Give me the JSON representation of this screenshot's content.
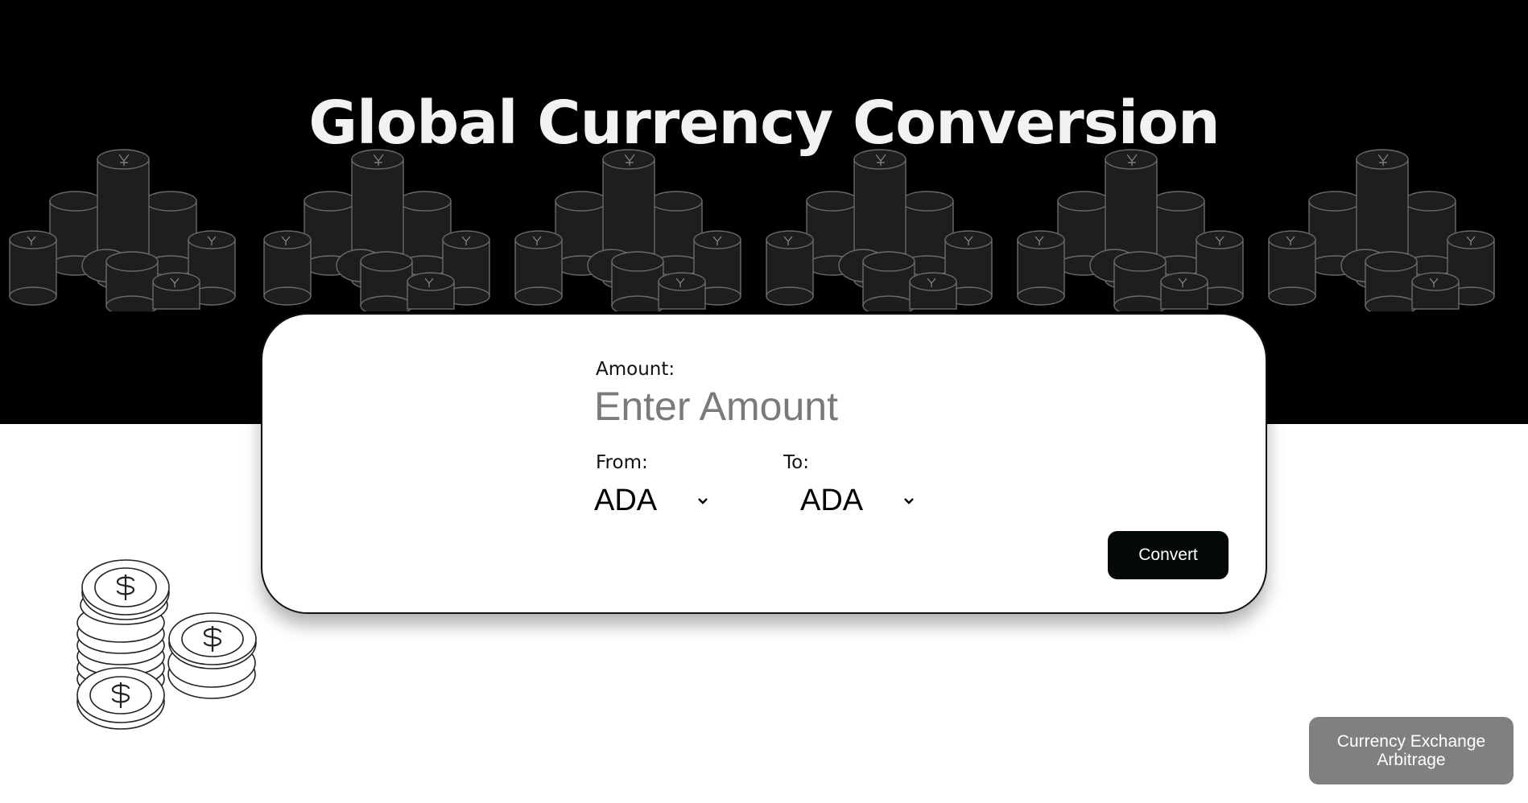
{
  "header": {
    "title": "Global Currency Conversion",
    "background_color": "#000000",
    "background_icon": "coin-stack-icon"
  },
  "converter": {
    "amount_label": "Amount:",
    "amount_value": "",
    "amount_placeholder": "Enter Amount",
    "from_label": "From:",
    "from_value": "ADA",
    "to_label": "To:",
    "to_value": "ADA",
    "convert_label": "Convert",
    "convert_color": "#030a05"
  },
  "decoration": {
    "icon": "dollar-coins-icon"
  },
  "footer": {
    "arbitrage_label": "Currency Exchange Arbitrage",
    "arbitrage_color": "#808080"
  }
}
